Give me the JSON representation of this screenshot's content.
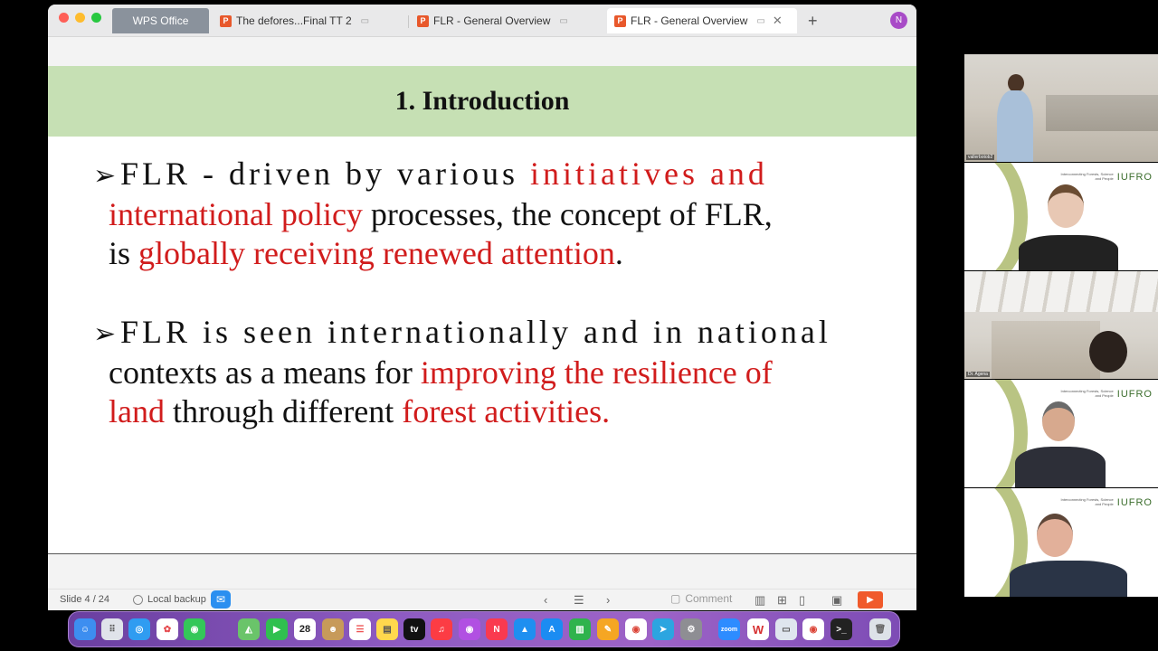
{
  "window": {
    "tabs": [
      {
        "label": "WPS Office"
      },
      {
        "label": "The defores...Final TT 2"
      },
      {
        "label": "FLR - General Overview"
      },
      {
        "label": "FLR - General Overview"
      }
    ],
    "new_tab_glyph": "+",
    "avatar_initial": "N",
    "close_glyph": "✕"
  },
  "slide": {
    "title": "1. Introduction",
    "p1": {
      "bullet": "➢",
      "a": "FLR - driven by various ",
      "b": "initiatives and",
      "c": "international policy",
      "d": " processes, the concept of  FLR,",
      "e": "is ",
      "f": "globally receiving renewed attention",
      "g": "."
    },
    "p2": {
      "bullet": "➢",
      "a": "FLR is seen internationally and in national",
      "b": "contexts as a means for ",
      "c": "improving the resilience of",
      "d": "land",
      "e": " through different ",
      "f": "forest activities."
    },
    "colors": {
      "header_bg": "#c6e0b4",
      "highlight_red": "#d11c1c"
    }
  },
  "statusbar": {
    "slide_indicator": "Slide 4 / 24",
    "backup": "Local backup",
    "comment": "Comment",
    "icons": [
      "chevron-left-icon",
      "outline-icon",
      "chevron-right-icon",
      "normal-view-icon",
      "grid-view-icon",
      "reading-view-icon",
      "present-icon",
      "play-icon"
    ]
  },
  "dock": {
    "icons": [
      "finder",
      "launchpad",
      "safari",
      "photos",
      "messages",
      "maps",
      "facetime",
      "calendar",
      "contacts",
      "reminders",
      "notes",
      "appletv",
      "music",
      "podcasts",
      "news",
      "keynote",
      "appstore",
      "numbers",
      "pages",
      "chrome",
      "telegram",
      "settings",
      "zoom",
      "wps",
      "screen",
      "chrome2",
      "terminal",
      "trash"
    ],
    "calendar_day": "28",
    "zoom_label": "zoom",
    "wps_label": "W"
  },
  "gallery": {
    "tiles": [
      {
        "name": "vallerbotob2"
      },
      {
        "name": ""
      },
      {
        "name": "Dr. Agena"
      },
      {
        "name": ""
      },
      {
        "name": ""
      }
    ],
    "iufro_tagline": "Interconnecting Forests, Science and People",
    "iufro_logo": "IUFRO"
  }
}
